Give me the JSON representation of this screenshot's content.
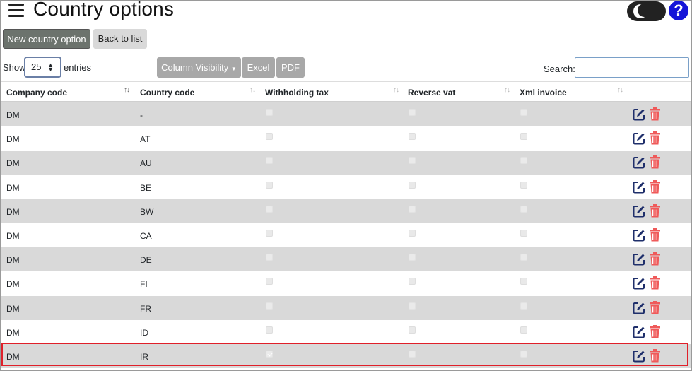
{
  "header": {
    "title": "Country options",
    "help_label": "?"
  },
  "toolbar": {
    "new_label": "New country option",
    "back_label": "Back to list"
  },
  "length": {
    "show_label": "Show",
    "value": "25",
    "entries_label": "entries"
  },
  "export_buttons": {
    "colvis_label": "Column Visibility",
    "excel_label": "Excel",
    "pdf_label": "PDF"
  },
  "search": {
    "label": "Search:",
    "value": ""
  },
  "table": {
    "columns": [
      "Company code",
      "Country code",
      "Withholding tax",
      "Reverse vat",
      "Xml invoice"
    ],
    "rows": [
      {
        "company": "DM",
        "country": "-",
        "withholding": false,
        "reverse_vat": false,
        "xml": false
      },
      {
        "company": "DM",
        "country": "AT",
        "withholding": false,
        "reverse_vat": false,
        "xml": false
      },
      {
        "company": "DM",
        "country": "AU",
        "withholding": false,
        "reverse_vat": false,
        "xml": false
      },
      {
        "company": "DM",
        "country": "BE",
        "withholding": false,
        "reverse_vat": false,
        "xml": false
      },
      {
        "company": "DM",
        "country": "BW",
        "withholding": false,
        "reverse_vat": false,
        "xml": false
      },
      {
        "company": "DM",
        "country": "CA",
        "withholding": false,
        "reverse_vat": false,
        "xml": false
      },
      {
        "company": "DM",
        "country": "DE",
        "withholding": false,
        "reverse_vat": false,
        "xml": false
      },
      {
        "company": "DM",
        "country": "FI",
        "withholding": false,
        "reverse_vat": false,
        "xml": false
      },
      {
        "company": "DM",
        "country": "FR",
        "withholding": false,
        "reverse_vat": false,
        "xml": false
      },
      {
        "company": "DM",
        "country": "ID",
        "withholding": false,
        "reverse_vat": false,
        "xml": false
      },
      {
        "company": "DM",
        "country": "IR",
        "withholding": true,
        "reverse_vat": false,
        "xml": false
      }
    ]
  },
  "colors": {
    "edit_icon": "#1f2f6b",
    "delete_icon": "#ef5a5a",
    "highlight": "#e0202a",
    "help": "#1414d8"
  }
}
